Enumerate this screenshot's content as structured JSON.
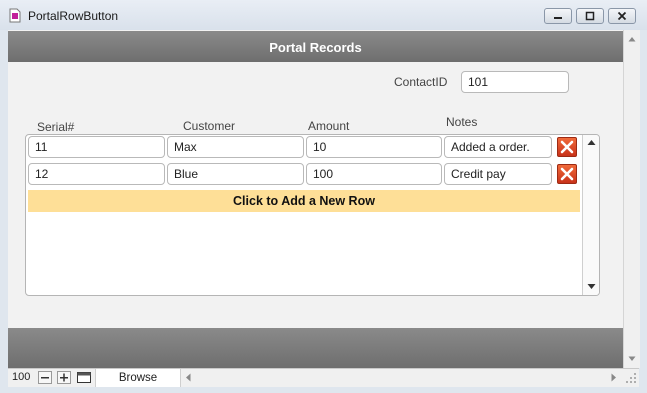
{
  "window": {
    "title": "PortalRowButton"
  },
  "layout": {
    "header_title": "Portal Records",
    "contact_id_label": "ContactID",
    "contact_id_value": "101"
  },
  "portal": {
    "columns": [
      "Serial#",
      "Customer",
      "Amount",
      "Notes"
    ],
    "rows": [
      {
        "serial": "11",
        "customer": "Max",
        "amount": "10",
        "notes": "Added a order."
      },
      {
        "serial": "12",
        "customer": "Blue",
        "amount": "100",
        "notes": "Credit pay"
      }
    ],
    "add_row_label": "Click to Add a New Row"
  },
  "statusbar": {
    "zoom": "100",
    "mode": "Browse"
  },
  "colors": {
    "header_band": "#7a7a7a",
    "add_row": "#fedf97",
    "delete_button": "#e04a24"
  },
  "icons": [
    "file-icon",
    "minimize-icon",
    "maximize-icon",
    "close-icon",
    "delete-icon",
    "scroll-up-icon",
    "scroll-down-icon",
    "zoom-out-icon",
    "zoom-in-icon",
    "layout-icon",
    "scroll-left-icon",
    "scroll-right-icon",
    "resize-grip-icon"
  ]
}
